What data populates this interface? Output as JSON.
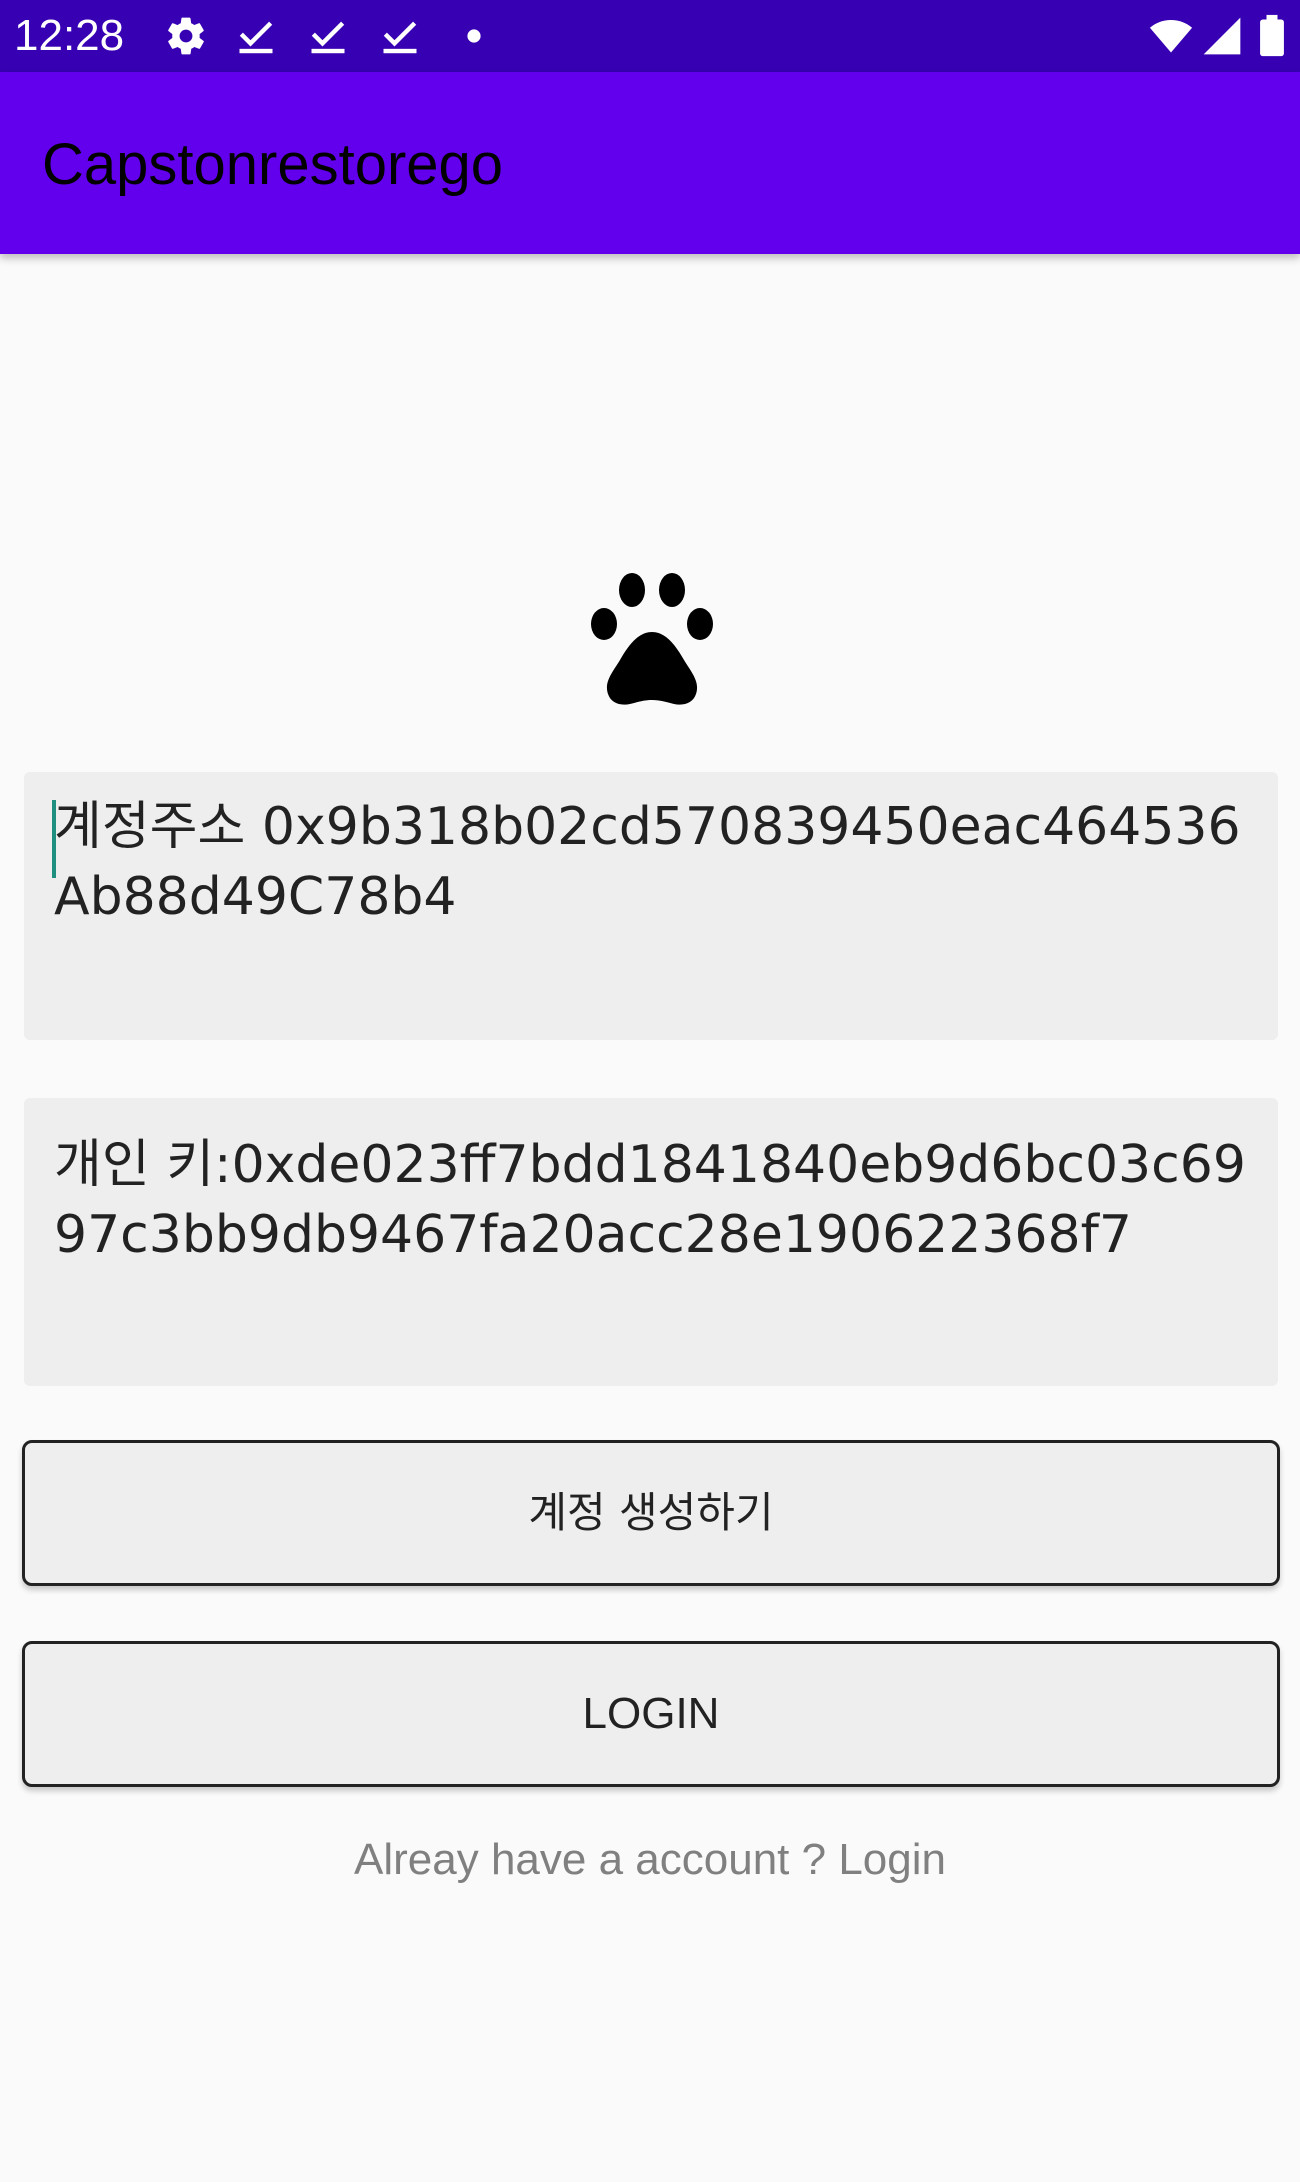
{
  "status_bar": {
    "time": "12:28",
    "left_icons": [
      "gear-icon",
      "check-icon",
      "check-icon",
      "check-icon",
      "dot-icon"
    ],
    "right_icons": [
      "wifi-icon",
      "signal-icon",
      "battery-icon"
    ],
    "background": "#3700b3"
  },
  "app_bar": {
    "title": "Capstonrestorego",
    "background": "#6200ee"
  },
  "logo": {
    "icon": "paw-icon"
  },
  "address_field": {
    "value": "계정주소 0x9b318b02cd570839450eac464536Ab88d49C78b4"
  },
  "key_field": {
    "value": "개인 키:0xde023ff7bdd1841840eb9d6bc03c6997c3bb9db9467fa20acc28e190622368f7"
  },
  "buttons": {
    "create_account": "계정 생성하기",
    "login": "LOGIN"
  },
  "login_link": "Alreay have a account ? Login"
}
